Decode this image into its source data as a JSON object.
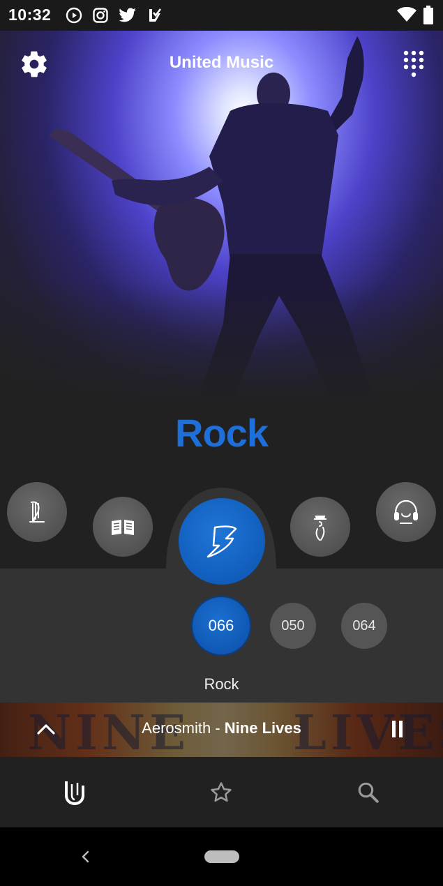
{
  "status_bar": {
    "time": "10:32",
    "icons": [
      "play-circle-icon",
      "instagram-icon",
      "twitter-icon",
      "check-flag-icon",
      "wifi-icon",
      "battery-icon"
    ]
  },
  "app": {
    "title": "United Music"
  },
  "genre": {
    "title": "Rock",
    "accent_color": "#1e6fd9"
  },
  "categories": {
    "items": [
      {
        "icon": "harp-icon"
      },
      {
        "icon": "book-icon"
      },
      {
        "icon": "rock-lightning-icon",
        "selected": true
      },
      {
        "icon": "crooner-hat-icon"
      },
      {
        "icon": "headphones-icon"
      }
    ]
  },
  "channels": {
    "items": [
      {
        "number": "066",
        "selected": true
      },
      {
        "number": "050"
      },
      {
        "number": "064"
      }
    ],
    "label": "Rock"
  },
  "now_playing": {
    "artist": "Aerosmith",
    "separator": " - ",
    "track": "Nine Lives",
    "album_art_text_left": "NINE",
    "album_art_text_right": "LIVES"
  },
  "bottom_nav": {
    "items": [
      {
        "icon": "united-logo-icon"
      },
      {
        "icon": "star-icon"
      },
      {
        "icon": "search-icon"
      }
    ]
  }
}
